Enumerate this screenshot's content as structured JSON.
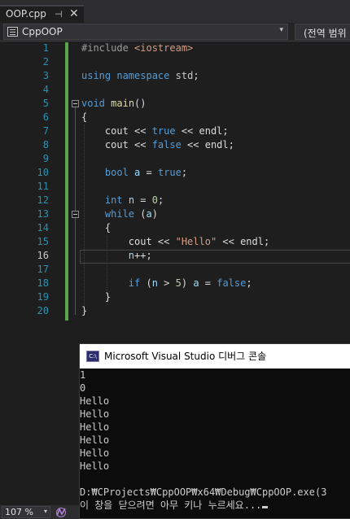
{
  "tab": {
    "label": "OOP.cpp",
    "pin": "⊣",
    "close": "✕"
  },
  "navbar": {
    "project": "CppOOP",
    "dropdown_arrow": "▾",
    "scope": "(전역 범위"
  },
  "editor": {
    "current_line": 16,
    "line_numbers": [
      "1",
      "2",
      "3",
      "4",
      "5",
      "6",
      "7",
      "8",
      "9",
      "10",
      "11",
      "12",
      "13",
      "14",
      "15",
      "16",
      "17",
      "18",
      "19",
      "20"
    ]
  },
  "console": {
    "title": "Microsoft Visual Studio 디버그 콘솔",
    "icon_text": "C:\\",
    "output": [
      "1",
      "0",
      "Hello",
      "Hello",
      "Hello",
      "Hello",
      "Hello",
      "Hello",
      "",
      "D:₩CProjects₩CppOOP₩x64₩Debug₩CppOOP.exe(3",
      "이 창을 닫으려면 아무 키나 누르세요..."
    ]
  },
  "status": {
    "zoom": "107 %",
    "zoom_arrow": "▾"
  },
  "colors": {
    "keyword": "#569cd6",
    "string": "#d69d85",
    "line_number": "#2b91af",
    "change_bar": "#57a64a"
  },
  "icons": [
    "pin-icon",
    "close-icon",
    "project-icon",
    "console-app-icon",
    "health-icon"
  ]
}
